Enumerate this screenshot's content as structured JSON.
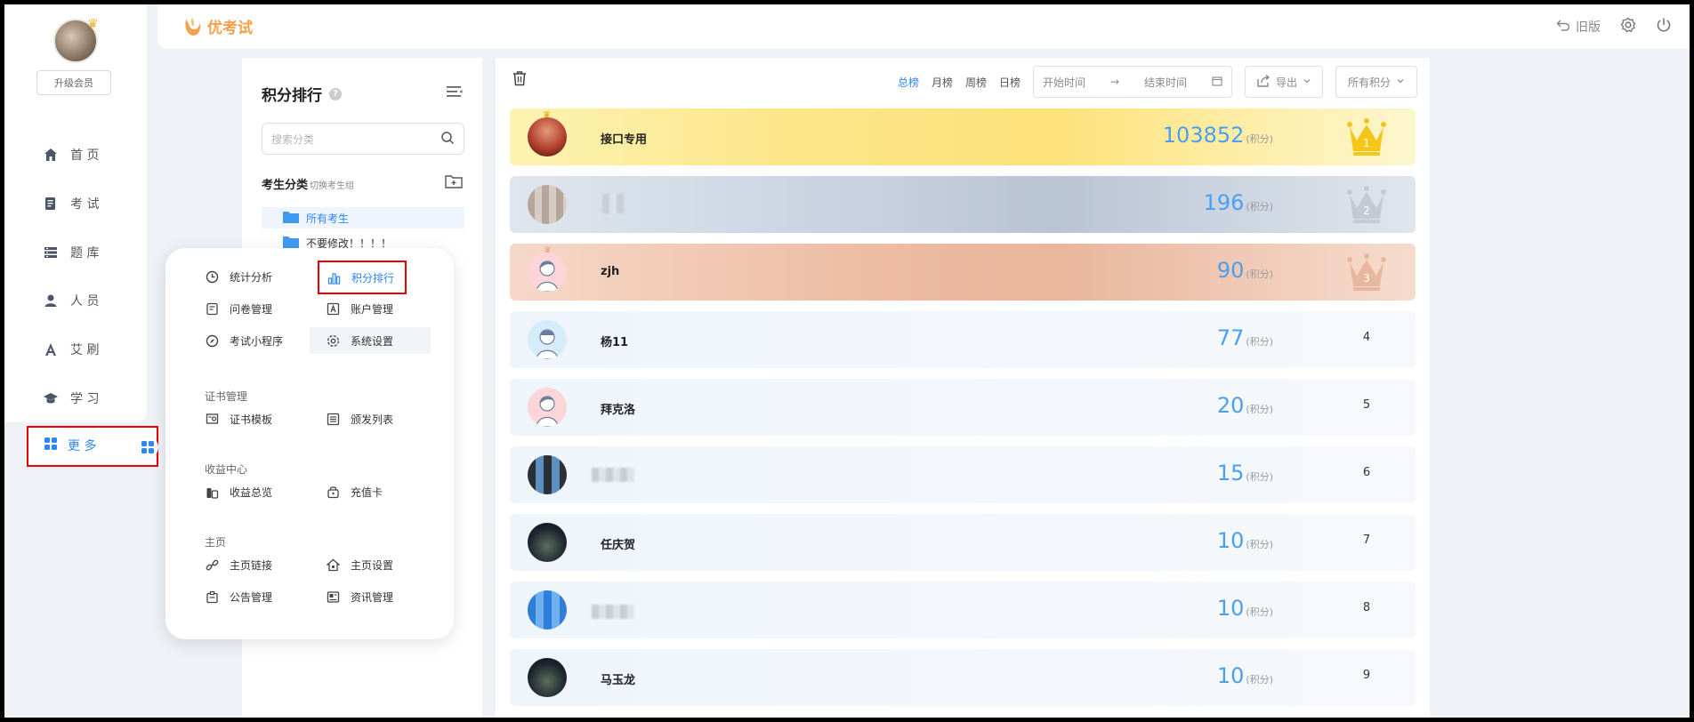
{
  "sidebar": {
    "upgrade_label": "升级会员",
    "items": [
      {
        "label": "首 页",
        "icon": "home-icon"
      },
      {
        "label": "考 试",
        "icon": "exam-icon"
      },
      {
        "label": "题 库",
        "icon": "question-bank-icon"
      },
      {
        "label": "人 员",
        "icon": "user-icon"
      },
      {
        "label": "艾 刷",
        "icon": "brush-icon"
      },
      {
        "label": "学 习",
        "icon": "graduation-cap-icon"
      }
    ],
    "more_label": "更 多"
  },
  "topbar": {
    "logo_text": "优考试",
    "old_version_label": "旧版"
  },
  "category_panel": {
    "title": "积分排行",
    "search_placeholder": "搜索分类",
    "section_title": "考生分类",
    "section_hint": "切换考生组",
    "folders": [
      "所有考生",
      "不要修改！！！！"
    ]
  },
  "popup": {
    "top_items": [
      {
        "label": "统计分析",
        "icon": "clock-icon"
      },
      {
        "label": "积分排行",
        "icon": "bar-chart-icon"
      },
      {
        "label": "问卷管理",
        "icon": "survey-icon"
      },
      {
        "label": "账户管理",
        "icon": "account-icon"
      },
      {
        "label": "考试小程序",
        "icon": "compass-icon"
      },
      {
        "label": "系统设置",
        "icon": "gear-icon"
      }
    ],
    "sections": [
      {
        "title": "证书管理",
        "items": [
          {
            "label": "证书模板",
            "icon": "certificate-icon"
          },
          {
            "label": "颁发列表",
            "icon": "list-icon"
          }
        ]
      },
      {
        "title": "收益中心",
        "items": [
          {
            "label": "收益总览",
            "icon": "coins-icon"
          },
          {
            "label": "充值卡",
            "icon": "card-icon"
          }
        ]
      },
      {
        "title": "主页",
        "items": [
          {
            "label": "主页链接",
            "icon": "link-icon"
          },
          {
            "label": "主页设置",
            "icon": "home-settings-icon"
          },
          {
            "label": "公告管理",
            "icon": "announcement-icon"
          },
          {
            "label": "资讯管理",
            "icon": "news-icon"
          }
        ]
      }
    ]
  },
  "main": {
    "tabs": [
      "总榜",
      "月榜",
      "周榜",
      "日榜"
    ],
    "active_tab": 0,
    "start_placeholder": "开始时间",
    "range_sep": "→",
    "end_placeholder": "结束时间",
    "export_label": "导出",
    "score_filter": "所有积分",
    "score_unit": "(积分)",
    "rows": [
      {
        "rank": "1",
        "name": "接口专用",
        "score": "103852"
      },
      {
        "rank": "2",
        "name": "",
        "score": "196"
      },
      {
        "rank": "3",
        "name": "zjh",
        "score": "90"
      },
      {
        "rank": "4",
        "name": "杨11",
        "score": "77"
      },
      {
        "rank": "5",
        "name": "拜克洛",
        "score": "20"
      },
      {
        "rank": "6",
        "name": "",
        "score": "15"
      },
      {
        "rank": "7",
        "name": "任庆贺",
        "score": "10"
      },
      {
        "rank": "8",
        "name": "",
        "score": "10"
      },
      {
        "rank": "9",
        "name": "马玉龙",
        "score": "10"
      }
    ]
  },
  "colors": {
    "accent": "#2f86f6",
    "gold": "#f5c518",
    "silver": "#c3cad6",
    "bronze": "#e7b89f",
    "highlight_border": "#e00000"
  }
}
